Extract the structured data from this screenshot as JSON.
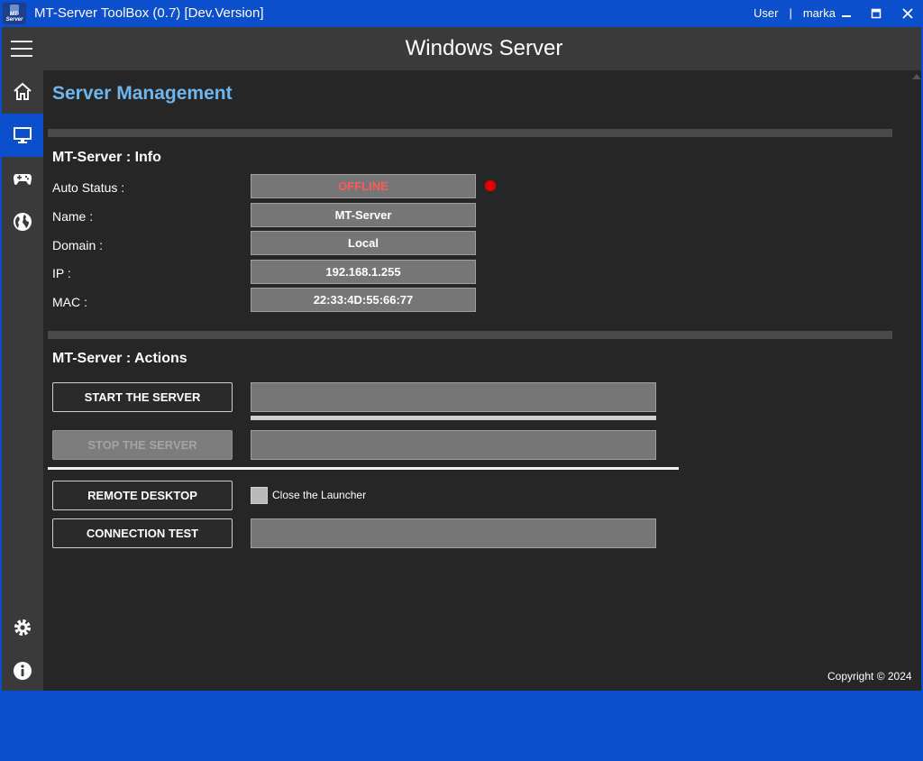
{
  "window": {
    "title": "MT-Server ToolBox (0.7) [Dev.Version]",
    "logo_text": "MT-Server",
    "user_label": "User",
    "user_separator": "|",
    "username": "marka",
    "controls": [
      "minimize-icon",
      "maximize-icon",
      "close-icon"
    ]
  },
  "header": {
    "title": "Windows Server"
  },
  "sidebar": {
    "items": [
      {
        "icon": "home-icon",
        "active": false
      },
      {
        "icon": "monitor-icon",
        "active": true
      },
      {
        "icon": "gamepad-icon",
        "active": false
      },
      {
        "icon": "globe-icon",
        "active": false
      }
    ],
    "bottom_items": [
      {
        "icon": "gear-icon"
      },
      {
        "icon": "info-icon"
      }
    ]
  },
  "main": {
    "section_title": "Server Management",
    "info": {
      "title": "MT-Server  : Info",
      "fields": [
        {
          "label": "Auto Status :",
          "value": "OFFLINE"
        },
        {
          "label": "Name :",
          "value": "MT-Server"
        },
        {
          "label": "Domain :",
          "value": "Local"
        },
        {
          "label": "IP :",
          "value": "192.168.1.255"
        },
        {
          "label": "MAC :",
          "value": "22:33:4D:55:66:77"
        }
      ],
      "status_color": "#e60000",
      "offline_text_color": "#ff5a5a"
    },
    "actions": {
      "title": "MT-Server  : Actions",
      "start_label": "START THE SERVER",
      "stop_label": "STOP THE SERVER",
      "remote_label": "REMOTE DESKTOP",
      "close_launcher_label": "Close the Launcher",
      "close_launcher_checked": false,
      "test_label": "CONNECTION TEST",
      "start_progress": 1.0
    },
    "copyright": "Copyright © 2024"
  },
  "colors": {
    "accent": "#0b4fcc",
    "heading": "#6fb6ee"
  }
}
